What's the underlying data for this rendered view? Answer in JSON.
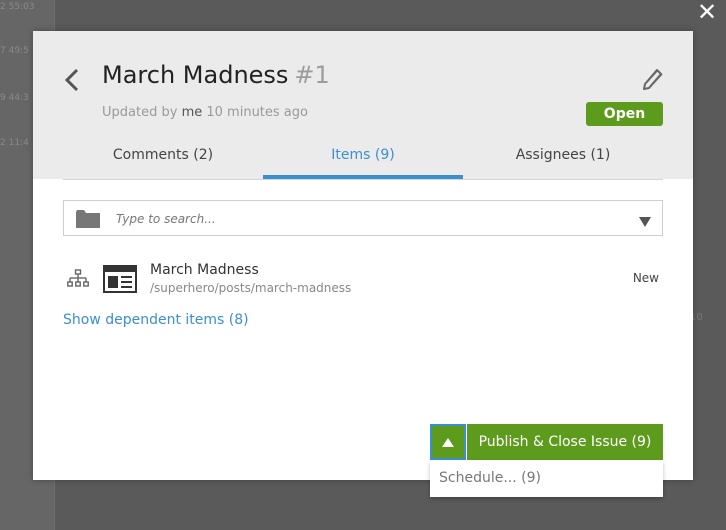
{
  "background": {
    "lines": [
      "2 55:03",
      "7 49:5",
      "9 44:3",
      "2 11:4"
    ],
    "right_text": "10"
  },
  "dialog": {
    "close_glyph": "✕",
    "title": "March Madness",
    "issue_number": "#1",
    "updated": {
      "prefix": "Updated by",
      "user": "me",
      "time": "10 minutes ago"
    },
    "status": "Open",
    "tabs": [
      {
        "label": "Comments (2)",
        "active": false
      },
      {
        "label": "Items (9)",
        "active": true
      },
      {
        "label": "Assignees (1)",
        "active": false
      }
    ],
    "search": {
      "placeholder": "Type to search...",
      "value": ""
    },
    "items": [
      {
        "title": "March Madness",
        "path": "/superhero/posts/march-madness",
        "status": "New"
      }
    ],
    "dependent_link": "Show dependent items (8)",
    "publish_label": "Publish & Close Issue (9)",
    "menu": [
      {
        "label": "Schedule... (9)"
      }
    ]
  },
  "colors": {
    "accent_green": "#5d9b1c",
    "link_blue": "#3b8fd0",
    "header_bg": "#ebebeb"
  },
  "icons": [
    "close-icon",
    "back-arrow-icon",
    "edit-pencil-icon",
    "folder-icon",
    "chevron-down-icon",
    "sitemap-icon",
    "newspaper-icon",
    "chevron-up-icon"
  ]
}
